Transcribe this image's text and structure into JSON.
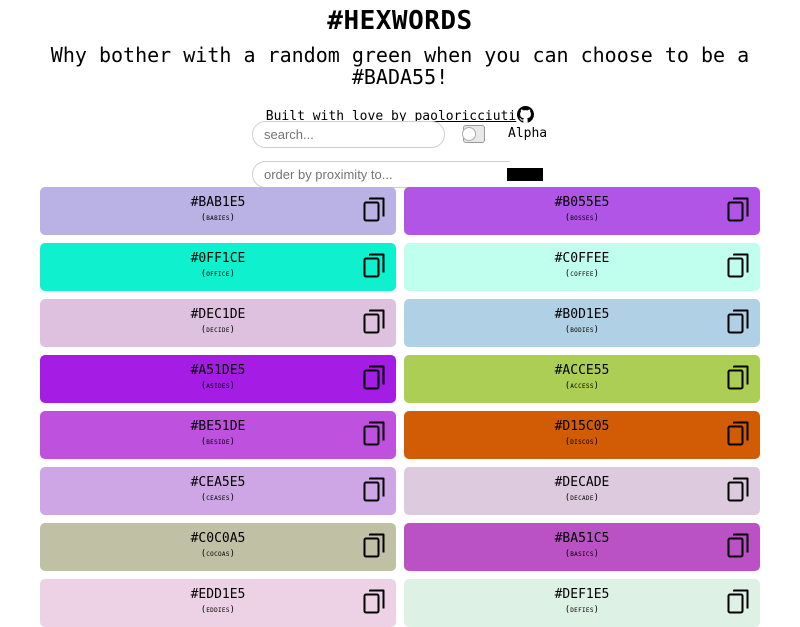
{
  "header": {
    "title": "#HEXWORDS",
    "subtitle": "Why bother with a random green when you can choose to be a #BADA55!",
    "credit_prefix": "Built with love by",
    "credit_author": "paoloricciuti"
  },
  "controls": {
    "search_placeholder": "search...",
    "alpha_label": "Alpha",
    "alpha_on": false,
    "order_placeholder": "order by proximity to...",
    "order_color": "#000000"
  },
  "icons": {
    "github": "github-icon",
    "copy": "copy-icon"
  },
  "cards": [
    {
      "hex": "#BAB1E5",
      "word": "(babies)",
      "color": "#BAB1E5"
    },
    {
      "hex": "#B055E5",
      "word": "(bosses)",
      "color": "#B055E5"
    },
    {
      "hex": "#0FF1CE",
      "word": "(office)",
      "color": "#0FF1CE"
    },
    {
      "hex": "#C0FFEE",
      "word": "(coffee)",
      "color": "#C0FFEE"
    },
    {
      "hex": "#DEC1DE",
      "word": "(decide)",
      "color": "#DEC1DE"
    },
    {
      "hex": "#B0D1E5",
      "word": "(bodies)",
      "color": "#B0D1E5"
    },
    {
      "hex": "#A51DE5",
      "word": "(asides)",
      "color": "#A51DE5"
    },
    {
      "hex": "#ACCE55",
      "word": "(access)",
      "color": "#ACCE55"
    },
    {
      "hex": "#BE51DE",
      "word": "(beside)",
      "color": "#BE51DE"
    },
    {
      "hex": "#D15C05",
      "word": "(discos)",
      "color": "#D15C05"
    },
    {
      "hex": "#CEA5E5",
      "word": "(ceases)",
      "color": "#CEA5E5"
    },
    {
      "hex": "#DECADE",
      "word": "(decade)",
      "color": "#DECADE"
    },
    {
      "hex": "#C0C0A5",
      "word": "(cocoas)",
      "color": "#C0C0A5"
    },
    {
      "hex": "#BA51C5",
      "word": "(basics)",
      "color": "#BA51C5"
    },
    {
      "hex": "#EDD1E5",
      "word": "(eddies)",
      "color": "#EDD1E5"
    },
    {
      "hex": "#DEF1E5",
      "word": "(defies)",
      "color": "#DEF1E5"
    }
  ]
}
